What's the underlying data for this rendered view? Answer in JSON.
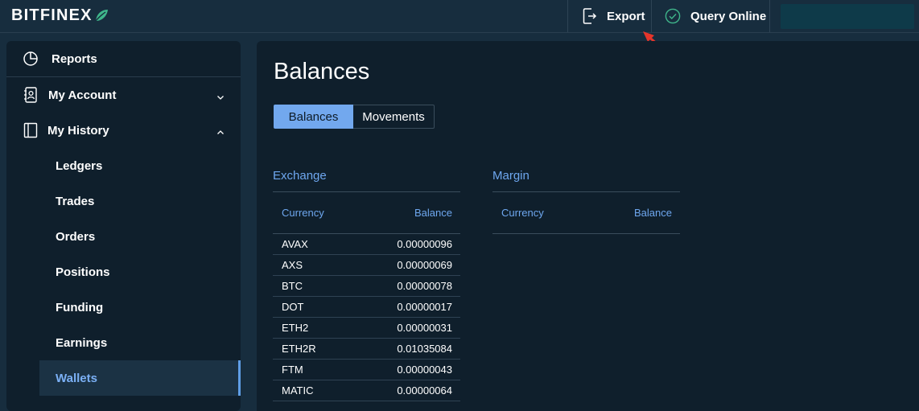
{
  "header": {
    "logo_text": "BITFINEX",
    "logo_leaf_color": "#3fb68b",
    "export_label": "Export",
    "query_label": "Query Online",
    "query_icon_color": "#3fb68b"
  },
  "sidebar": {
    "reports": "Reports",
    "my_account": "My Account",
    "my_history": "My History",
    "sub_items": [
      "Ledgers",
      "Trades",
      "Orders",
      "Positions",
      "Funding",
      "Earnings",
      "Wallets"
    ],
    "active_item": "Wallets"
  },
  "main": {
    "title": "Balances",
    "tabs": [
      "Balances",
      "Movements"
    ],
    "active_tab": "Balances",
    "exchange": {
      "title": "Exchange",
      "col_currency": "Currency",
      "col_balance": "Balance",
      "rows": [
        {
          "currency": "AVAX",
          "balance": "0.00000096"
        },
        {
          "currency": "AXS",
          "balance": "0.00000069"
        },
        {
          "currency": "BTC",
          "balance": "0.00000078"
        },
        {
          "currency": "DOT",
          "balance": "0.00000017"
        },
        {
          "currency": "ETH2",
          "balance": "0.00000031"
        },
        {
          "currency": "ETH2R",
          "balance": "0.01035084"
        },
        {
          "currency": "FTM",
          "balance": "0.00000043"
        },
        {
          "currency": "MATIC",
          "balance": "0.00000064"
        }
      ]
    },
    "margin": {
      "title": "Margin",
      "col_currency": "Currency",
      "col_balance": "Balance"
    }
  },
  "colors": {
    "accent": "#6ea7ef",
    "active_tab": "#72a8ee",
    "annotation_arrow": "#e5352b"
  }
}
